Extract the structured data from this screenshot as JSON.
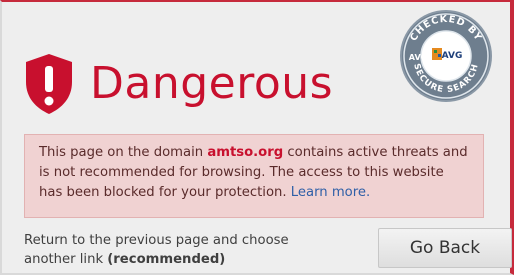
{
  "header": {
    "title": "Dangerous",
    "shield_icon": "shield-exclamation-icon",
    "seal": {
      "top_text": "CHECKED BY",
      "bottom_text": "SECURE SEARCH",
      "side_text": "AVG",
      "logo_text": "AVG"
    }
  },
  "alert": {
    "text_before": "This page on the domain ",
    "domain": "amtso.org",
    "text_after": " contains active threats and is not recommended for browsing. The access to this website has been blocked for your protection. ",
    "link": "Learn more."
  },
  "footer": {
    "return_text": "Return to the previous page and choose another link ",
    "recommended": "(recommended)",
    "go_back_label": "Go Back"
  },
  "colors": {
    "danger": "#c8102e",
    "alert_bg": "#f0d2d2",
    "link": "#2f5fa7"
  }
}
